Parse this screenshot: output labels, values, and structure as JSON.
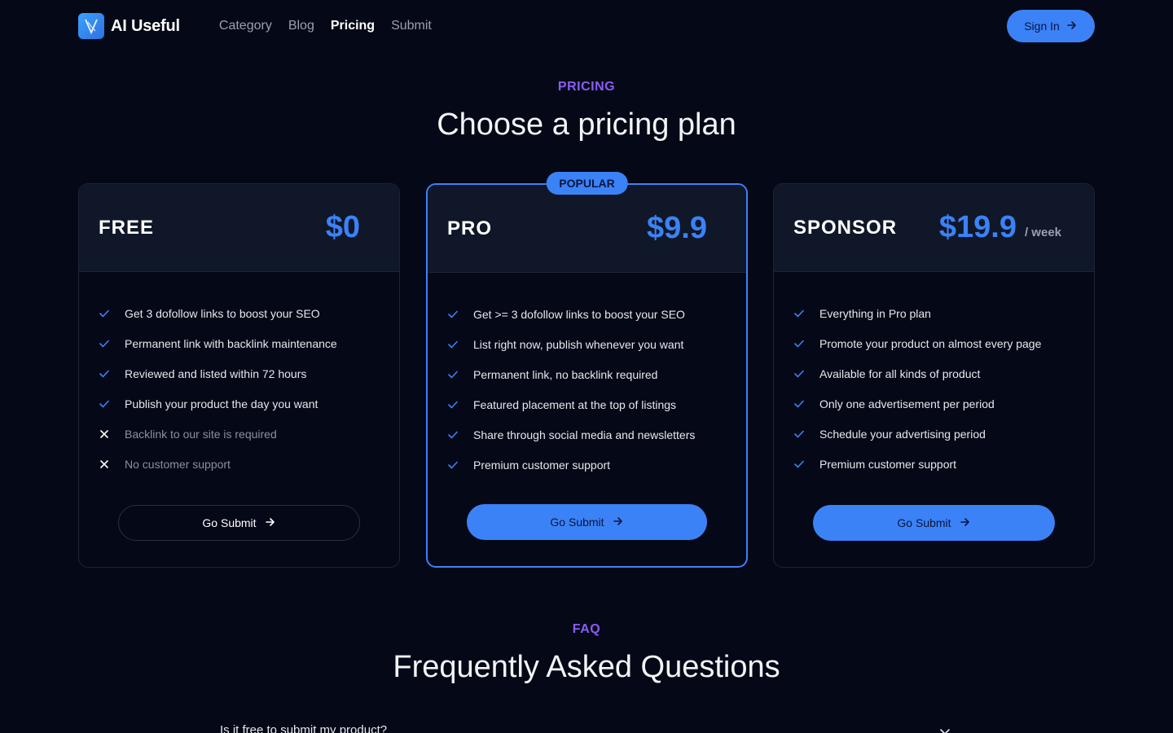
{
  "header": {
    "brand": "AI Useful",
    "nav": [
      {
        "label": "Category",
        "active": false
      },
      {
        "label": "Blog",
        "active": false
      },
      {
        "label": "Pricing",
        "active": true
      },
      {
        "label": "Submit",
        "active": false
      }
    ],
    "sign_in": "Sign In"
  },
  "pricing": {
    "eyebrow": "PRICING",
    "title": "Choose a pricing plan"
  },
  "plans": [
    {
      "name": "FREE",
      "price": "$0",
      "period": "",
      "badge": "",
      "features": [
        {
          "text": "Get 3 dofollow links to boost your SEO",
          "included": true
        },
        {
          "text": "Permanent link with backlink maintenance",
          "included": true
        },
        {
          "text": "Reviewed and listed within 72 hours",
          "included": true
        },
        {
          "text": "Publish your product the day you want",
          "included": true
        },
        {
          "text": "Backlink to our site is required",
          "included": false
        },
        {
          "text": "No customer support",
          "included": false
        }
      ],
      "cta": "Go Submit"
    },
    {
      "name": "PRO",
      "price": "$9.9",
      "period": "",
      "badge": "POPULAR",
      "features": [
        {
          "text": "Get >= 3 dofollow links to boost your SEO",
          "included": true
        },
        {
          "text": "List right now, publish whenever you want",
          "included": true
        },
        {
          "text": "Permanent link, no backlink required",
          "included": true
        },
        {
          "text": "Featured placement at the top of listings",
          "included": true
        },
        {
          "text": "Share through social media and newsletters",
          "included": true
        },
        {
          "text": "Premium customer support",
          "included": true
        }
      ],
      "cta": "Go Submit"
    },
    {
      "name": "SPONSOR",
      "price": "$19.9",
      "period": "/ week",
      "badge": "",
      "features": [
        {
          "text": "Everything in Pro plan",
          "included": true
        },
        {
          "text": "Promote your product on almost every page",
          "included": true
        },
        {
          "text": "Available for all kinds of product",
          "included": true
        },
        {
          "text": "Only one advertisement per period",
          "included": true
        },
        {
          "text": "Schedule your advertising period",
          "included": true
        },
        {
          "text": "Premium customer support",
          "included": true
        }
      ],
      "cta": "Go Submit"
    }
  ],
  "faq": {
    "eyebrow": "FAQ",
    "title": "Frequently Asked Questions",
    "first_question": "Is it free to submit my product?"
  },
  "colors": {
    "background": "#050816",
    "accent": "#3b82f6",
    "eyebrow": "#8b5cf6",
    "card_head": "#0f1729"
  },
  "icons": {
    "logo": "logo-mark-icon",
    "arrow": "arrow-right-icon",
    "check": "check-icon",
    "cross": "x-icon",
    "chevron": "chevron-down-icon"
  }
}
